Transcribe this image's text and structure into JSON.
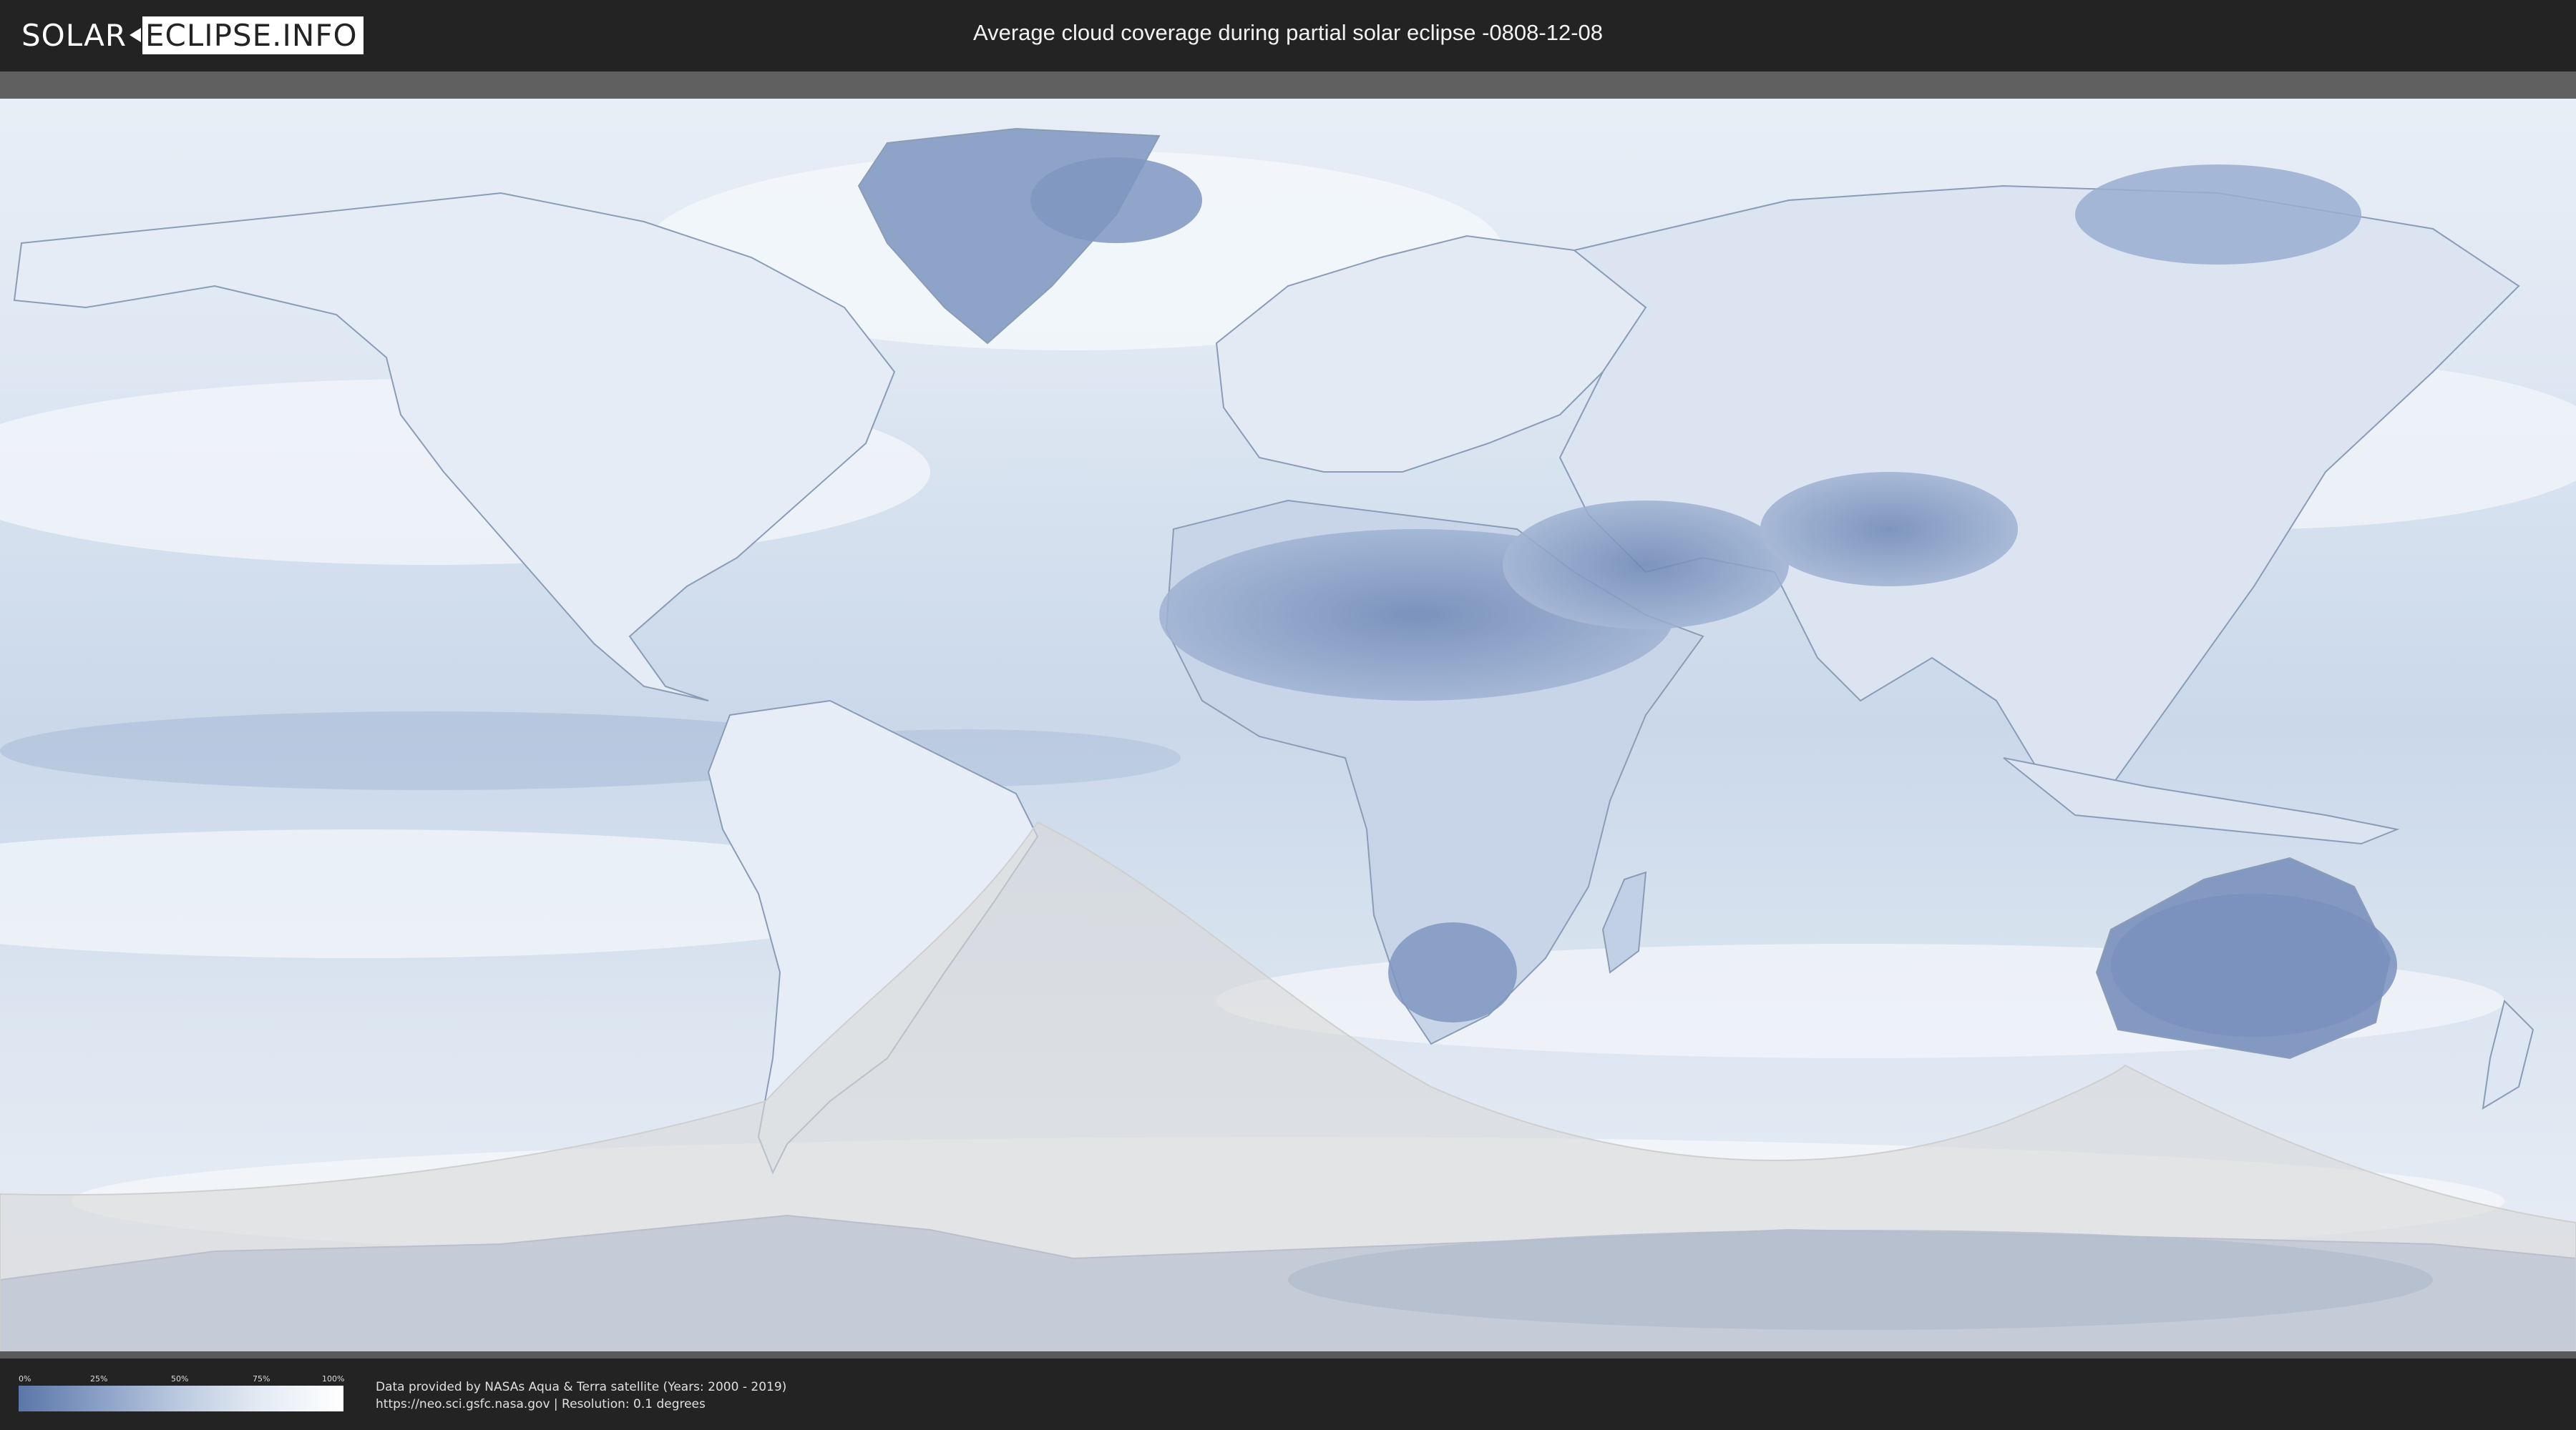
{
  "header": {
    "logo_part1": "SOLAR",
    "logo_part2": "ECLIPSE.INFO",
    "title": "Average cloud coverage during partial solar eclipse -0808-12-08"
  },
  "legend": {
    "ticks": [
      "0%",
      "25%",
      "50%",
      "75%",
      "100%"
    ],
    "colors": {
      "low_cloud": "#5b77a8",
      "high_cloud": "#ffffff",
      "eclipse_zone": "#d9d9d9"
    }
  },
  "credits": {
    "line1": "Data provided by NASAs Aqua & Terra satellite (Years: 2000 - 2019)",
    "line2": "https://neo.sci.gsfc.nasa.gov | Resolution: 0.1 degrees"
  }
}
